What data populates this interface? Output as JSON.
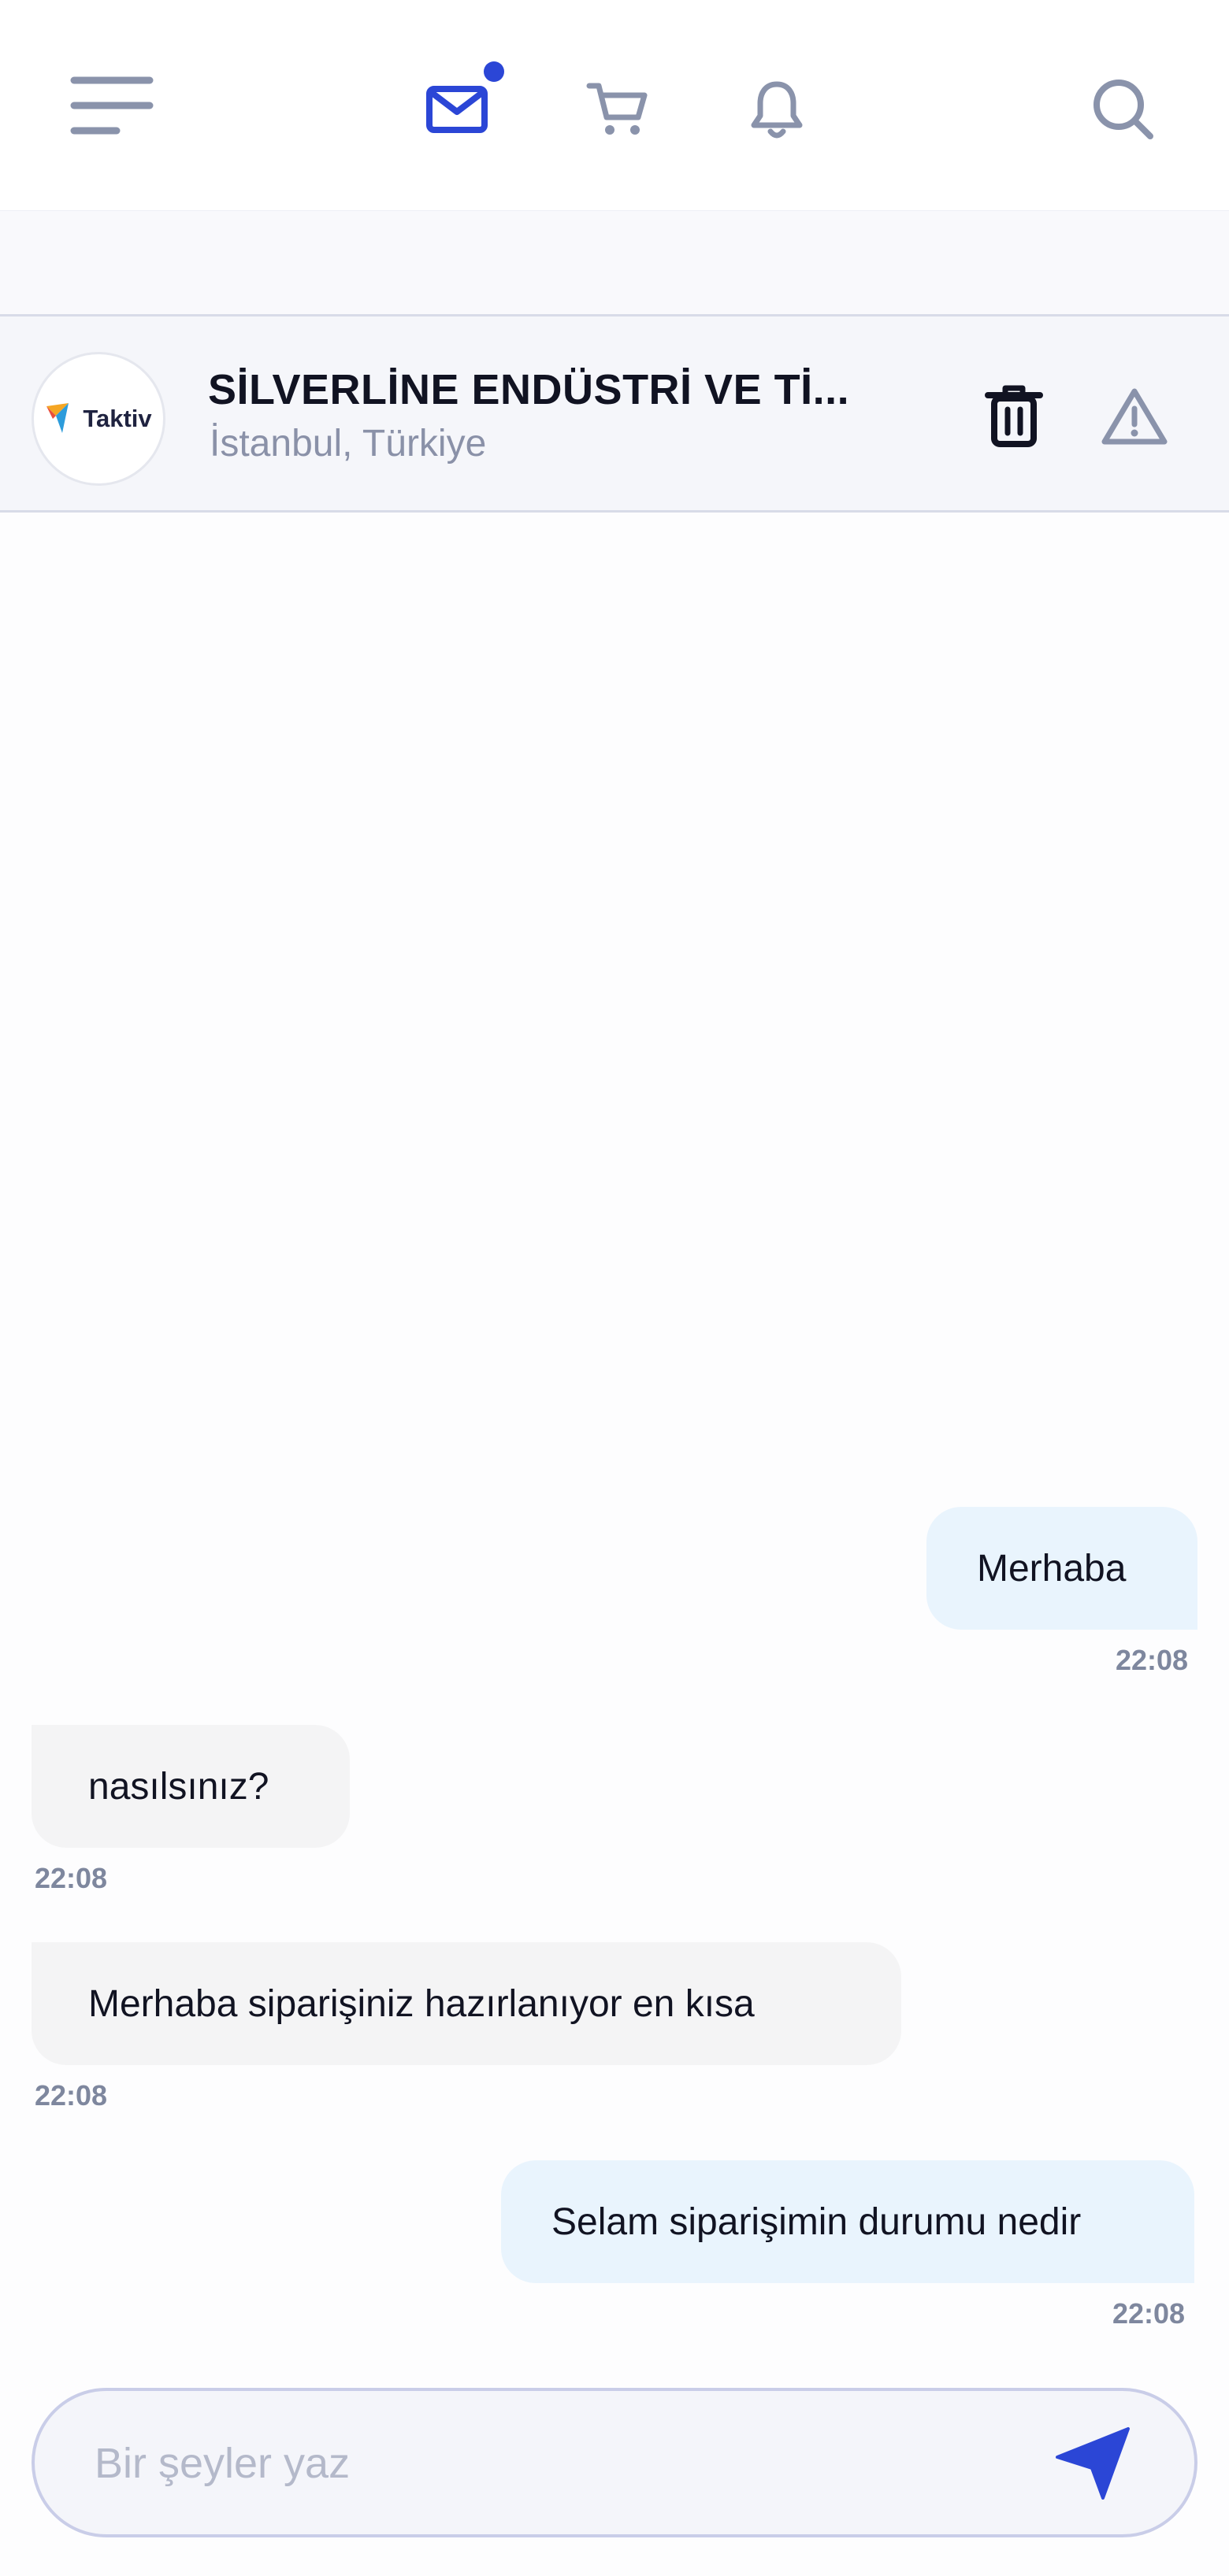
{
  "nav": {
    "icons": [
      "menu-icon",
      "mail-icon",
      "cart-icon",
      "bell-icon",
      "search-icon"
    ],
    "mail_unread_indicator": true,
    "accent_color": "#2b46d6",
    "icon_color": "#8a93ab"
  },
  "chat_header": {
    "avatar_logo_text": "Taktiv",
    "company_name": "SİLVERLİNE ENDÜSTRİ VE Tİ...",
    "location": "İstanbul, Türkiye"
  },
  "messages": [
    {
      "direction": "sent",
      "text": "Merhaba",
      "time": "22:08"
    },
    {
      "direction": "received",
      "text": "nasılsınız?",
      "time": "22:08"
    },
    {
      "direction": "received",
      "text": "Merhaba siparişiniz hazırlanıyor en kısa",
      "time": "22:08"
    },
    {
      "direction": "sent",
      "text": "Selam siparişimin durumu nedir",
      "time": "22:08"
    }
  ],
  "composer": {
    "placeholder": "Bir şeyler yaz",
    "value": ""
  },
  "colors": {
    "sent_bubble": "#e9f4fd",
    "received_bubble": "#f4f4f5",
    "send_icon": "#2b46d6"
  }
}
